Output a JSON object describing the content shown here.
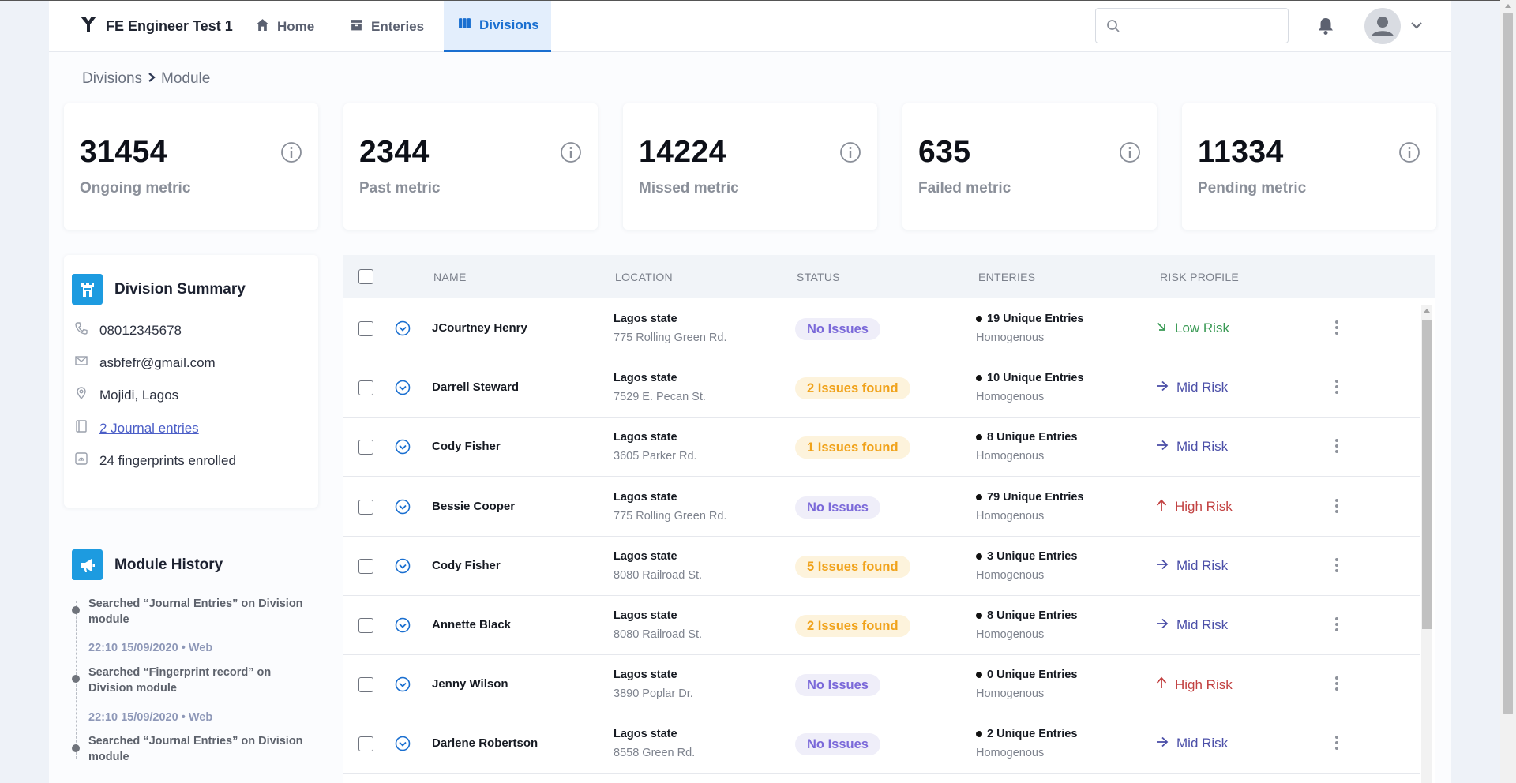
{
  "nav": {
    "brand": "FE Engineer Test 1",
    "tabs": [
      {
        "label": "Home",
        "icon": "home-icon"
      },
      {
        "label": "Enteries",
        "icon": "archive-icon"
      },
      {
        "label": "Divisions",
        "icon": "divisions-icon",
        "active": true
      }
    ],
    "search_placeholder": ""
  },
  "breadcrumb": {
    "parent": "Divisions",
    "current": "Module"
  },
  "metrics": [
    {
      "value": "31454",
      "label": "Ongoing metric"
    },
    {
      "value": "2344",
      "label": "Past metric"
    },
    {
      "value": "14224",
      "label": "Missed metric"
    },
    {
      "value": "635",
      "label": "Failed metric"
    },
    {
      "value": "11334",
      "label": "Pending metric"
    }
  ],
  "summary": {
    "title": "Division Summary",
    "phone": "08012345678",
    "email": "asbfefr@gmail.com",
    "location": "Mojidi, Lagos",
    "journal": "2 Journal entries",
    "fingerprints": "24 fingerprints enrolled"
  },
  "history": {
    "title": "Module History",
    "items": [
      {
        "text": "Searched “Journal Entries” on Division module",
        "time": "22:10 15/09/2020",
        "source": "Web"
      },
      {
        "text": "Searched “Fingerprint record” on Division module",
        "time": "22:10 15/09/2020",
        "source": "Web"
      },
      {
        "text": "Searched “Journal Entries” on Division module"
      }
    ]
  },
  "table": {
    "headers": [
      "NAME",
      "LOCATION",
      "STATUS",
      "ENTERIES",
      "RISK PROFILE"
    ],
    "rows": [
      {
        "name": "JCourtney Henry",
        "state": "Lagos state",
        "address": "775 Rolling Green Rd.",
        "status": "No Issues",
        "status_type": "ok",
        "entries": "19 Unique Entries",
        "entries_type": "Homogenous",
        "risk": "Low Risk",
        "risk_level": "low"
      },
      {
        "name": "Darrell Steward",
        "state": "Lagos state",
        "address": "7529 E. Pecan St.",
        "status": "2 Issues found",
        "status_type": "warn",
        "entries": "10 Unique Entries",
        "entries_type": "Homogenous",
        "risk": "Mid Risk",
        "risk_level": "mid"
      },
      {
        "name": "Cody Fisher",
        "state": "Lagos state",
        "address": "3605 Parker Rd.",
        "status": "1 Issues found",
        "status_type": "warn",
        "entries": "8 Unique Entries",
        "entries_type": "Homogenous",
        "risk": "Mid Risk",
        "risk_level": "mid"
      },
      {
        "name": "Bessie Cooper",
        "state": "Lagos state",
        "address": "775 Rolling Green Rd.",
        "status": "No Issues",
        "status_type": "ok",
        "entries": "79 Unique Entries",
        "entries_type": "Homogenous",
        "risk": "High Risk",
        "risk_level": "high"
      },
      {
        "name": "Cody Fisher",
        "state": "Lagos state",
        "address": "8080 Railroad St.",
        "status": "5 Issues found",
        "status_type": "warn",
        "entries": "3 Unique Entries",
        "entries_type": "Homogenous",
        "risk": "Mid Risk",
        "risk_level": "mid"
      },
      {
        "name": "Annette Black",
        "state": "Lagos state",
        "address": "8080 Railroad St.",
        "status": "2 Issues found",
        "status_type": "warn",
        "entries": "8 Unique Entries",
        "entries_type": "Homogenous",
        "risk": "Mid Risk",
        "risk_level": "mid"
      },
      {
        "name": "Jenny Wilson",
        "state": "Lagos state",
        "address": "3890 Poplar Dr.",
        "status": "No Issues",
        "status_type": "ok",
        "entries": "0 Unique Entries",
        "entries_type": "Homogenous",
        "risk": "High Risk",
        "risk_level": "high"
      },
      {
        "name": "Darlene Robertson",
        "state": "Lagos state",
        "address": "8558 Green Rd.",
        "status": "No Issues",
        "status_type": "ok",
        "entries": "2 Unique Entries",
        "entries_type": "Homogenous",
        "risk": "Mid Risk",
        "risk_level": "mid"
      }
    ]
  },
  "colors": {
    "accent": "#1a6fd0",
    "icon_bg": "#1d9be0",
    "low_risk": "#3a9a55",
    "mid_risk": "#4b4fa8",
    "high_risk": "#c24141",
    "warn": "#f0a21a",
    "ok": "#7b69d9"
  }
}
